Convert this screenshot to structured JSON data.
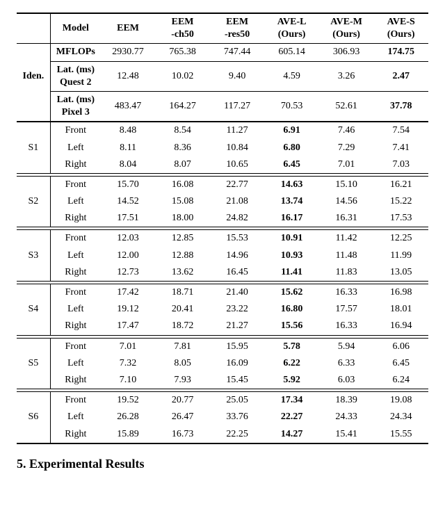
{
  "header": {
    "iden": "Iden.",
    "model": "Model",
    "cols": [
      "EEM",
      "EEM\n-ch50",
      "EEM\n-res50",
      "AVE-L\n(Ours)",
      "AVE-M\n(Ours)",
      "AVE-S\n(Ours)"
    ]
  },
  "iden_rows": {
    "mflops": {
      "label": "MFLOPs",
      "vals": [
        "2930.77",
        "765.38",
        "747.44",
        "605.14",
        "306.93",
        "174.75"
      ],
      "bold_idx": 5
    },
    "latq": {
      "label1": "Lat. (ms)",
      "label2": "Quest 2",
      "vals": [
        "12.48",
        "10.02",
        "9.40",
        "4.59",
        "3.26",
        "2.47"
      ],
      "bold_idx": 5
    },
    "latp": {
      "label1": "Lat. (ms)",
      "label2": "Pixel 3",
      "vals": [
        "483.47",
        "164.27",
        "117.27",
        "70.53",
        "52.61",
        "37.78"
      ],
      "bold_idx": 5
    }
  },
  "sets": [
    {
      "name": "S1",
      "rows": [
        {
          "label": "Front",
          "vals": [
            "8.48",
            "8.54",
            "11.27",
            "6.91",
            "7.46",
            "7.54"
          ],
          "bold_idx": 3
        },
        {
          "label": "Left",
          "vals": [
            "8.11",
            "8.36",
            "10.84",
            "6.80",
            "7.29",
            "7.41"
          ],
          "bold_idx": 3
        },
        {
          "label": "Right",
          "vals": [
            "8.04",
            "8.07",
            "10.65",
            "6.45",
            "7.01",
            "7.03"
          ],
          "bold_idx": 3
        }
      ]
    },
    {
      "name": "S2",
      "rows": [
        {
          "label": "Front",
          "vals": [
            "15.70",
            "16.08",
            "22.77",
            "14.63",
            "15.10",
            "16.21"
          ],
          "bold_idx": 3
        },
        {
          "label": "Left",
          "vals": [
            "14.52",
            "15.08",
            "21.08",
            "13.74",
            "14.56",
            "15.22"
          ],
          "bold_idx": 3
        },
        {
          "label": "Right",
          "vals": [
            "17.51",
            "18.00",
            "24.82",
            "16.17",
            "16.31",
            "17.53"
          ],
          "bold_idx": 3
        }
      ]
    },
    {
      "name": "S3",
      "rows": [
        {
          "label": "Front",
          "vals": [
            "12.03",
            "12.85",
            "15.53",
            "10.91",
            "11.42",
            "12.25"
          ],
          "bold_idx": 3
        },
        {
          "label": "Left",
          "vals": [
            "12.00",
            "12.88",
            "14.96",
            "10.93",
            "11.48",
            "11.99"
          ],
          "bold_idx": 3
        },
        {
          "label": "Right",
          "vals": [
            "12.73",
            "13.62",
            "16.45",
            "11.41",
            "11.83",
            "13.05"
          ],
          "bold_idx": 3
        }
      ]
    },
    {
      "name": "S4",
      "rows": [
        {
          "label": "Front",
          "vals": [
            "17.42",
            "18.71",
            "21.40",
            "15.62",
            "16.33",
            "16.98"
          ],
          "bold_idx": 3
        },
        {
          "label": "Left",
          "vals": [
            "19.12",
            "20.41",
            "23.22",
            "16.80",
            "17.57",
            "18.01"
          ],
          "bold_idx": 3
        },
        {
          "label": "Right",
          "vals": [
            "17.47",
            "18.72",
            "21.27",
            "15.56",
            "16.33",
            "16.94"
          ],
          "bold_idx": 3
        }
      ]
    },
    {
      "name": "S5",
      "rows": [
        {
          "label": "Front",
          "vals": [
            "7.01",
            "7.81",
            "15.95",
            "5.78",
            "5.94",
            "6.06"
          ],
          "bold_idx": 3
        },
        {
          "label": "Left",
          "vals": [
            "7.32",
            "8.05",
            "16.09",
            "6.22",
            "6.33",
            "6.45"
          ],
          "bold_idx": 3
        },
        {
          "label": "Right",
          "vals": [
            "7.10",
            "7.93",
            "15.45",
            "5.92",
            "6.03",
            "6.24"
          ],
          "bold_idx": 3
        }
      ]
    },
    {
      "name": "S6",
      "rows": [
        {
          "label": "Front",
          "vals": [
            "19.52",
            "20.77",
            "25.05",
            "17.34",
            "18.39",
            "19.08"
          ],
          "bold_idx": 3
        },
        {
          "label": "Left",
          "vals": [
            "26.28",
            "26.47",
            "33.76",
            "22.27",
            "24.33",
            "24.34"
          ],
          "bold_idx": 3
        },
        {
          "label": "Right",
          "vals": [
            "15.89",
            "16.73",
            "22.25",
            "14.27",
            "15.41",
            "15.55"
          ],
          "bold_idx": 3
        }
      ]
    }
  ],
  "section_heading": "5. Experimental Results",
  "chart_data": {
    "type": "table",
    "title": "Model comparison across subjects",
    "columns": [
      "EEM",
      "EEM-ch50",
      "EEM-res50",
      "AVE-L (Ours)",
      "AVE-M (Ours)",
      "AVE-S (Ours)"
    ],
    "identity_metrics": {
      "MFLOPs": [
        2930.77,
        765.38,
        747.44,
        605.14,
        306.93,
        174.75
      ],
      "Lat.(ms) Quest 2": [
        12.48,
        10.02,
        9.4,
        4.59,
        3.26,
        2.47
      ],
      "Lat.(ms) Pixel 3": [
        483.47,
        164.27,
        117.27,
        70.53,
        52.61,
        37.78
      ]
    },
    "subjects": {
      "S1": {
        "Front": [
          8.48,
          8.54,
          11.27,
          6.91,
          7.46,
          7.54
        ],
        "Left": [
          8.11,
          8.36,
          10.84,
          6.8,
          7.29,
          7.41
        ],
        "Right": [
          8.04,
          8.07,
          10.65,
          6.45,
          7.01,
          7.03
        ]
      },
      "S2": {
        "Front": [
          15.7,
          16.08,
          22.77,
          14.63,
          15.1,
          16.21
        ],
        "Left": [
          14.52,
          15.08,
          21.08,
          13.74,
          14.56,
          15.22
        ],
        "Right": [
          17.51,
          18.0,
          24.82,
          16.17,
          16.31,
          17.53
        ]
      },
      "S3": {
        "Front": [
          12.03,
          12.85,
          15.53,
          10.91,
          11.42,
          12.25
        ],
        "Left": [
          12.0,
          12.88,
          14.96,
          10.93,
          11.48,
          11.99
        ],
        "Right": [
          12.73,
          13.62,
          16.45,
          11.41,
          11.83,
          13.05
        ]
      },
      "S4": {
        "Front": [
          17.42,
          18.71,
          21.4,
          15.62,
          16.33,
          16.98
        ],
        "Left": [
          19.12,
          20.41,
          23.22,
          16.8,
          17.57,
          18.01
        ],
        "Right": [
          17.47,
          18.72,
          21.27,
          15.56,
          16.33,
          16.94
        ]
      },
      "S5": {
        "Front": [
          7.01,
          7.81,
          15.95,
          5.78,
          5.94,
          6.06
        ],
        "Left": [
          7.32,
          8.05,
          16.09,
          6.22,
          6.33,
          6.45
        ],
        "Right": [
          7.1,
          7.93,
          15.45,
          5.92,
          6.03,
          6.24
        ]
      },
      "S6": {
        "Front": [
          19.52,
          20.77,
          25.05,
          17.34,
          18.39,
          19.08
        ],
        "Left": [
          26.28,
          26.47,
          33.76,
          22.27,
          24.33,
          24.34
        ],
        "Right": [
          15.89,
          16.73,
          22.25,
          14.27,
          15.41,
          15.55
        ]
      }
    }
  }
}
